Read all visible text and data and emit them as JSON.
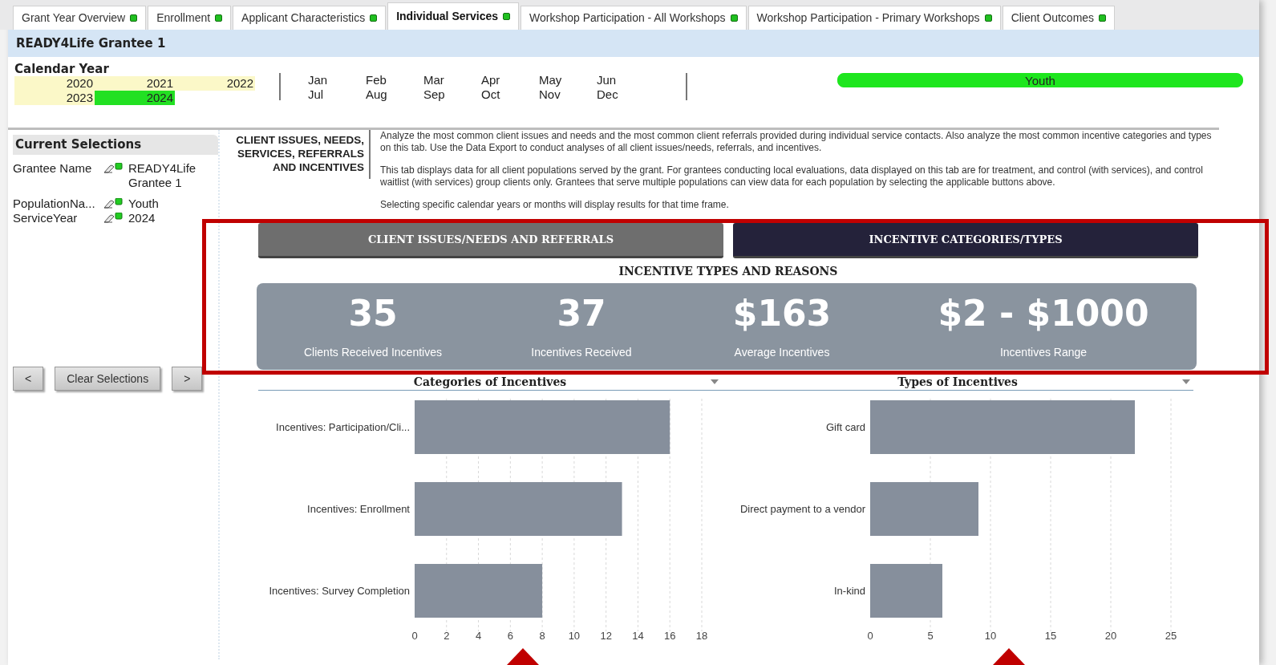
{
  "tabs": [
    {
      "label": "Grant Year Overview",
      "selected": false
    },
    {
      "label": "Enrollment",
      "selected": false
    },
    {
      "label": "Applicant Characteristics",
      "selected": false
    },
    {
      "label": "Individual Services",
      "selected": true
    },
    {
      "label": "Workshop Participation - All Workshops",
      "selected": false
    },
    {
      "label": "Workshop Participation - Primary Workshops",
      "selected": false
    },
    {
      "label": "Client Outcomes",
      "selected": false
    }
  ],
  "header": {
    "title": "READY4Life Grantee 1"
  },
  "calendar": {
    "label": "Calendar Year",
    "years": [
      {
        "label": "2020",
        "selected": false
      },
      {
        "label": "2021",
        "selected": false
      },
      {
        "label": "2022",
        "selected": false
      },
      {
        "label": "2023",
        "selected": false
      },
      {
        "label": "2024",
        "selected": true
      }
    ],
    "months": [
      {
        "label": "Jan",
        "selected": false
      },
      {
        "label": "Feb",
        "selected": false
      },
      {
        "label": "Mar",
        "selected": false
      },
      {
        "label": "Apr",
        "selected": false
      },
      {
        "label": "May",
        "selected": false
      },
      {
        "label": "Jun",
        "selected": false
      },
      {
        "label": "Jul",
        "selected": false
      },
      {
        "label": "Aug",
        "selected": false
      },
      {
        "label": "Sep",
        "selected": false
      },
      {
        "label": "Oct",
        "selected": false
      },
      {
        "label": "Nov",
        "selected": false
      },
      {
        "label": "Dec",
        "selected": false
      }
    ],
    "populations": [
      {
        "label": "Youth",
        "selected": true
      }
    ]
  },
  "current_selections": {
    "title": "Current Selections",
    "items": [
      {
        "field": "Grantee Name",
        "value": "READY4Life Grantee 1"
      },
      {
        "field": "PopulationNa...",
        "value": "Youth"
      },
      {
        "field": "ServiceYear",
        "value": "2024"
      }
    ],
    "buttons": {
      "previous": "<",
      "clear": "Clear Selections",
      "next": ">"
    }
  },
  "section": {
    "title": "CLIENT ISSUES, NEEDS, SERVICES, REFERRALS AND INCENTIVES",
    "paragraphs": [
      "Analyze the most common client issues and needs and the most common client referrals provided during individual service contacts. Also analyze the most common incentive categories and types on this tab. Use the Data Export to conduct analyses of all client  issues/needs, referrals, and incentives.",
      "This tab displays data for all client populations served by the grant. For grantees conducting local evaluations, data displayed on this tab are for treatment, and control (with services), and control waitlist (with services) group clients only. Grantees that serve multiple populations can view data for each population by selecting the applicable buttons above.",
      "Selecting specific calendar years or months will display results for that time frame."
    ]
  },
  "view_buttons": [
    {
      "label": "CLIENT ISSUES/NEEDS AND REFERRALS",
      "selected": false
    },
    {
      "label": "INCENTIVE CATEGORIES/TYPES",
      "selected": true
    }
  ],
  "kpi_title": "INCENTIVE TYPES AND REASONS",
  "kpis": [
    {
      "value": "35",
      "label": "Clients Received Incentives"
    },
    {
      "value": "37",
      "label": "Incentives Received"
    },
    {
      "value": "$163",
      "label": "Average Incentives"
    },
    {
      "value": "$2 - $1000",
      "label": "Incentives Range"
    }
  ],
  "charts": [
    {
      "title": "Categories of Incentives",
      "chart_data": {
        "type": "bar",
        "orientation": "horizontal",
        "categories": [
          "Incentives: Participation/Cli...",
          "Incentives: Enrollment",
          "Incentives: Survey Completion"
        ],
        "values": [
          16,
          13,
          8
        ],
        "grid": true,
        "xlim": [
          0,
          18
        ],
        "xticks": [
          0,
          2,
          4,
          6,
          8,
          10,
          12,
          14,
          16,
          18
        ]
      }
    },
    {
      "title": "Types of Incentives",
      "chart_data": {
        "type": "bar",
        "orientation": "horizontal",
        "categories": [
          "Gift card",
          "Direct payment to a vendor",
          "In-kind"
        ],
        "values": [
          22,
          9,
          6
        ],
        "grid": true,
        "xlim": [
          0,
          25
        ],
        "xticks": [
          0,
          5,
          10,
          15,
          20,
          25
        ]
      }
    }
  ]
}
